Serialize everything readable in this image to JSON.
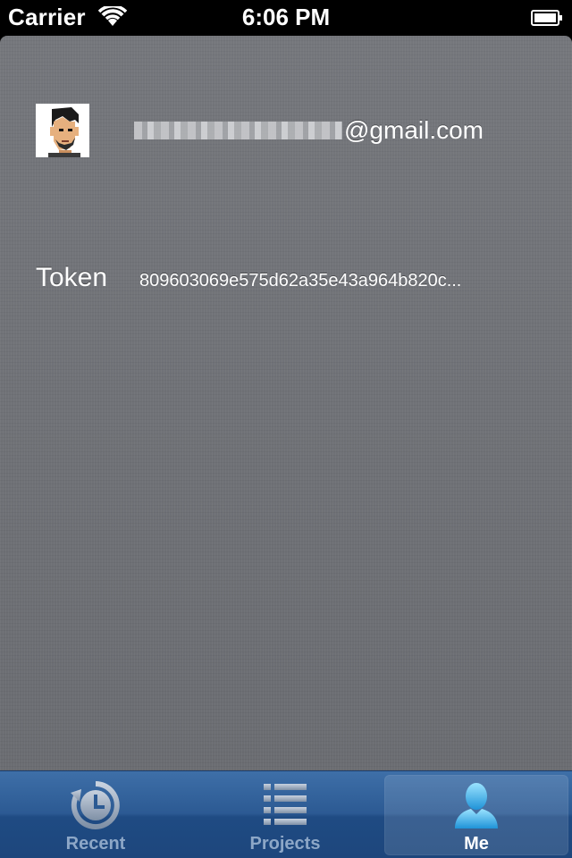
{
  "status_bar": {
    "carrier": "Carrier",
    "time": "6:06 PM"
  },
  "profile": {
    "email_visible_part": "@gmail.com",
    "token_label": "Token",
    "token_value": "809603069e575d62a35e43a964b820c..."
  },
  "tab_bar": {
    "tabs": [
      {
        "label": "Recent",
        "icon": "clock-history-icon",
        "selected": false
      },
      {
        "label": "Projects",
        "icon": "list-icon",
        "selected": false
      },
      {
        "label": "Me",
        "icon": "person-icon",
        "selected": true
      }
    ]
  },
  "colors": {
    "tab_bar": "#2c5a93",
    "content_background": "#6f7176",
    "selected_icon": "#3ab0ec"
  }
}
